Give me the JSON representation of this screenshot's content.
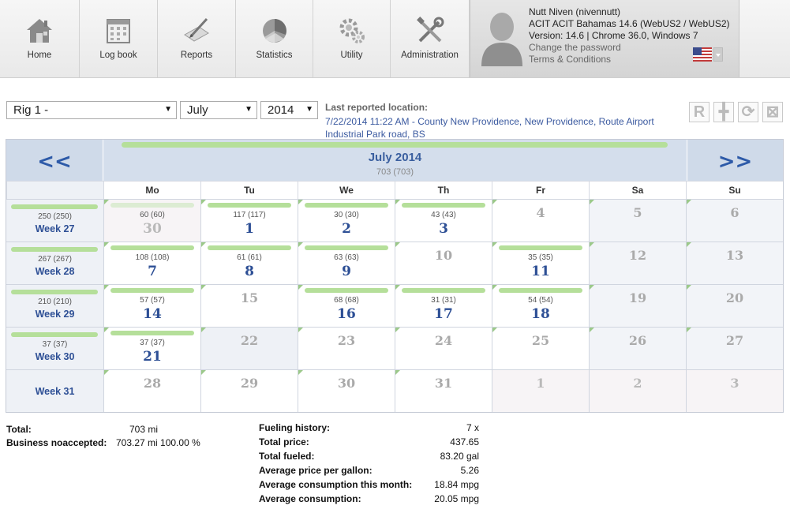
{
  "nav": {
    "items": [
      {
        "label": "Home",
        "icon": "home-icon"
      },
      {
        "label": "Log book",
        "icon": "logbook-icon"
      },
      {
        "label": "Reports",
        "icon": "reports-icon"
      },
      {
        "label": "Statistics",
        "icon": "statistics-icon"
      },
      {
        "label": "Utility",
        "icon": "utility-icon"
      },
      {
        "label": "Administration",
        "icon": "administration-icon"
      }
    ]
  },
  "user": {
    "name": "Nutt Niven (nivennutt)",
    "company": "ACIT ACIT Bahamas 14.6 (WebUS2 / WebUS2)",
    "version": "Version: 14.6  |  Chrome 36.0, Windows 7",
    "change_password": "Change the password",
    "terms": "Terms & Conditions"
  },
  "filters": {
    "rig": "Rig 1 -",
    "month": "July",
    "year": "2014"
  },
  "location": {
    "title": "Last reported location:",
    "text": "7/22/2014 11:22 AM - County New Providence, New Providence, Route Airport Industrial Park road, BS"
  },
  "tools": [
    "R",
    "╋",
    "⟳",
    "⊠"
  ],
  "calendar": {
    "prev": "<<",
    "next": ">>",
    "title": "July 2014",
    "subtitle": "703 (703)",
    "day_headers": [
      "Mo",
      "Tu",
      "We",
      "Th",
      "Fr",
      "Sa",
      "Su"
    ],
    "weeks": [
      {
        "label": "Week 27",
        "miles": "250 (250)",
        "bar": 1.0,
        "days": [
          {
            "n": "30",
            "mi": "60 (60)",
            "bar": 0.7,
            "type": "other"
          },
          {
            "n": "1",
            "mi": "117 (117)",
            "bar": 1.0,
            "type": "day"
          },
          {
            "n": "2",
            "mi": "30 (30)",
            "bar": 1.0,
            "type": "day"
          },
          {
            "n": "3",
            "mi": "43 (43)",
            "bar": 1.0,
            "type": "day"
          },
          {
            "n": "4",
            "mi": "",
            "bar": 0,
            "type": "empty"
          },
          {
            "n": "5",
            "mi": "",
            "bar": 0,
            "type": "weekend"
          },
          {
            "n": "6",
            "mi": "",
            "bar": 0,
            "type": "weekend"
          }
        ]
      },
      {
        "label": "Week 28",
        "miles": "267 (267)",
        "bar": 1.0,
        "days": [
          {
            "n": "7",
            "mi": "108 (108)",
            "bar": 1.0,
            "type": "day"
          },
          {
            "n": "8",
            "mi": "61 (61)",
            "bar": 1.0,
            "type": "day"
          },
          {
            "n": "9",
            "mi": "63 (63)",
            "bar": 1.0,
            "type": "day"
          },
          {
            "n": "10",
            "mi": "",
            "bar": 0,
            "type": "empty"
          },
          {
            "n": "11",
            "mi": "35 (35)",
            "bar": 1.0,
            "type": "day"
          },
          {
            "n": "12",
            "mi": "",
            "bar": 0,
            "type": "weekend"
          },
          {
            "n": "13",
            "mi": "",
            "bar": 0,
            "type": "weekend"
          }
        ]
      },
      {
        "label": "Week 29",
        "miles": "210 (210)",
        "bar": 1.0,
        "days": [
          {
            "n": "14",
            "mi": "57 (57)",
            "bar": 1.0,
            "type": "day"
          },
          {
            "n": "15",
            "mi": "",
            "bar": 0,
            "type": "empty"
          },
          {
            "n": "16",
            "mi": "68 (68)",
            "bar": 1.0,
            "type": "day"
          },
          {
            "n": "17",
            "mi": "31 (31)",
            "bar": 1.0,
            "type": "day"
          },
          {
            "n": "18",
            "mi": "54 (54)",
            "bar": 1.0,
            "type": "day"
          },
          {
            "n": "19",
            "mi": "",
            "bar": 0,
            "type": "weekend"
          },
          {
            "n": "20",
            "mi": "",
            "bar": 0,
            "type": "weekend"
          }
        ]
      },
      {
        "label": "Week 30",
        "miles": "37 (37)",
        "bar": 1.0,
        "days": [
          {
            "n": "21",
            "mi": "37 (37)",
            "bar": 1.0,
            "type": "day"
          },
          {
            "n": "22",
            "mi": "",
            "bar": 0,
            "type": "today"
          },
          {
            "n": "23",
            "mi": "",
            "bar": 0,
            "type": "empty"
          },
          {
            "n": "24",
            "mi": "",
            "bar": 0,
            "type": "empty"
          },
          {
            "n": "25",
            "mi": "",
            "bar": 0,
            "type": "empty"
          },
          {
            "n": "26",
            "mi": "",
            "bar": 0,
            "type": "weekend"
          },
          {
            "n": "27",
            "mi": "",
            "bar": 0,
            "type": "weekend"
          }
        ]
      },
      {
        "label": "Week 31",
        "miles": "",
        "bar": 0,
        "days": [
          {
            "n": "28",
            "mi": "",
            "bar": 0,
            "type": "empty"
          },
          {
            "n": "29",
            "mi": "",
            "bar": 0,
            "type": "empty"
          },
          {
            "n": "30",
            "mi": "",
            "bar": 0,
            "type": "empty"
          },
          {
            "n": "31",
            "mi": "",
            "bar": 0,
            "type": "empty"
          },
          {
            "n": "1",
            "mi": "",
            "bar": 0,
            "type": "othernext"
          },
          {
            "n": "2",
            "mi": "",
            "bar": 0,
            "type": "weekendnext"
          },
          {
            "n": "3",
            "mi": "",
            "bar": 0,
            "type": "weekendnext"
          }
        ]
      }
    ]
  },
  "summary": {
    "total_label": "Total:",
    "total_value": "703 mi",
    "business_label": "Business noaccepted:",
    "business_value": "703.27 mi  100.00 %",
    "rows": [
      {
        "label": "Fueling history:",
        "value": "7 x"
      },
      {
        "label": "Total price:",
        "value": "437.65"
      },
      {
        "label": "Total fueled:",
        "value": "83.20 gal"
      },
      {
        "label": "Average price per gallon:",
        "value": "5.26"
      },
      {
        "label": "Average consumption this month:",
        "value": "18.84 mpg"
      },
      {
        "label": "Average consumption:",
        "value": "20.05 mpg"
      }
    ]
  }
}
